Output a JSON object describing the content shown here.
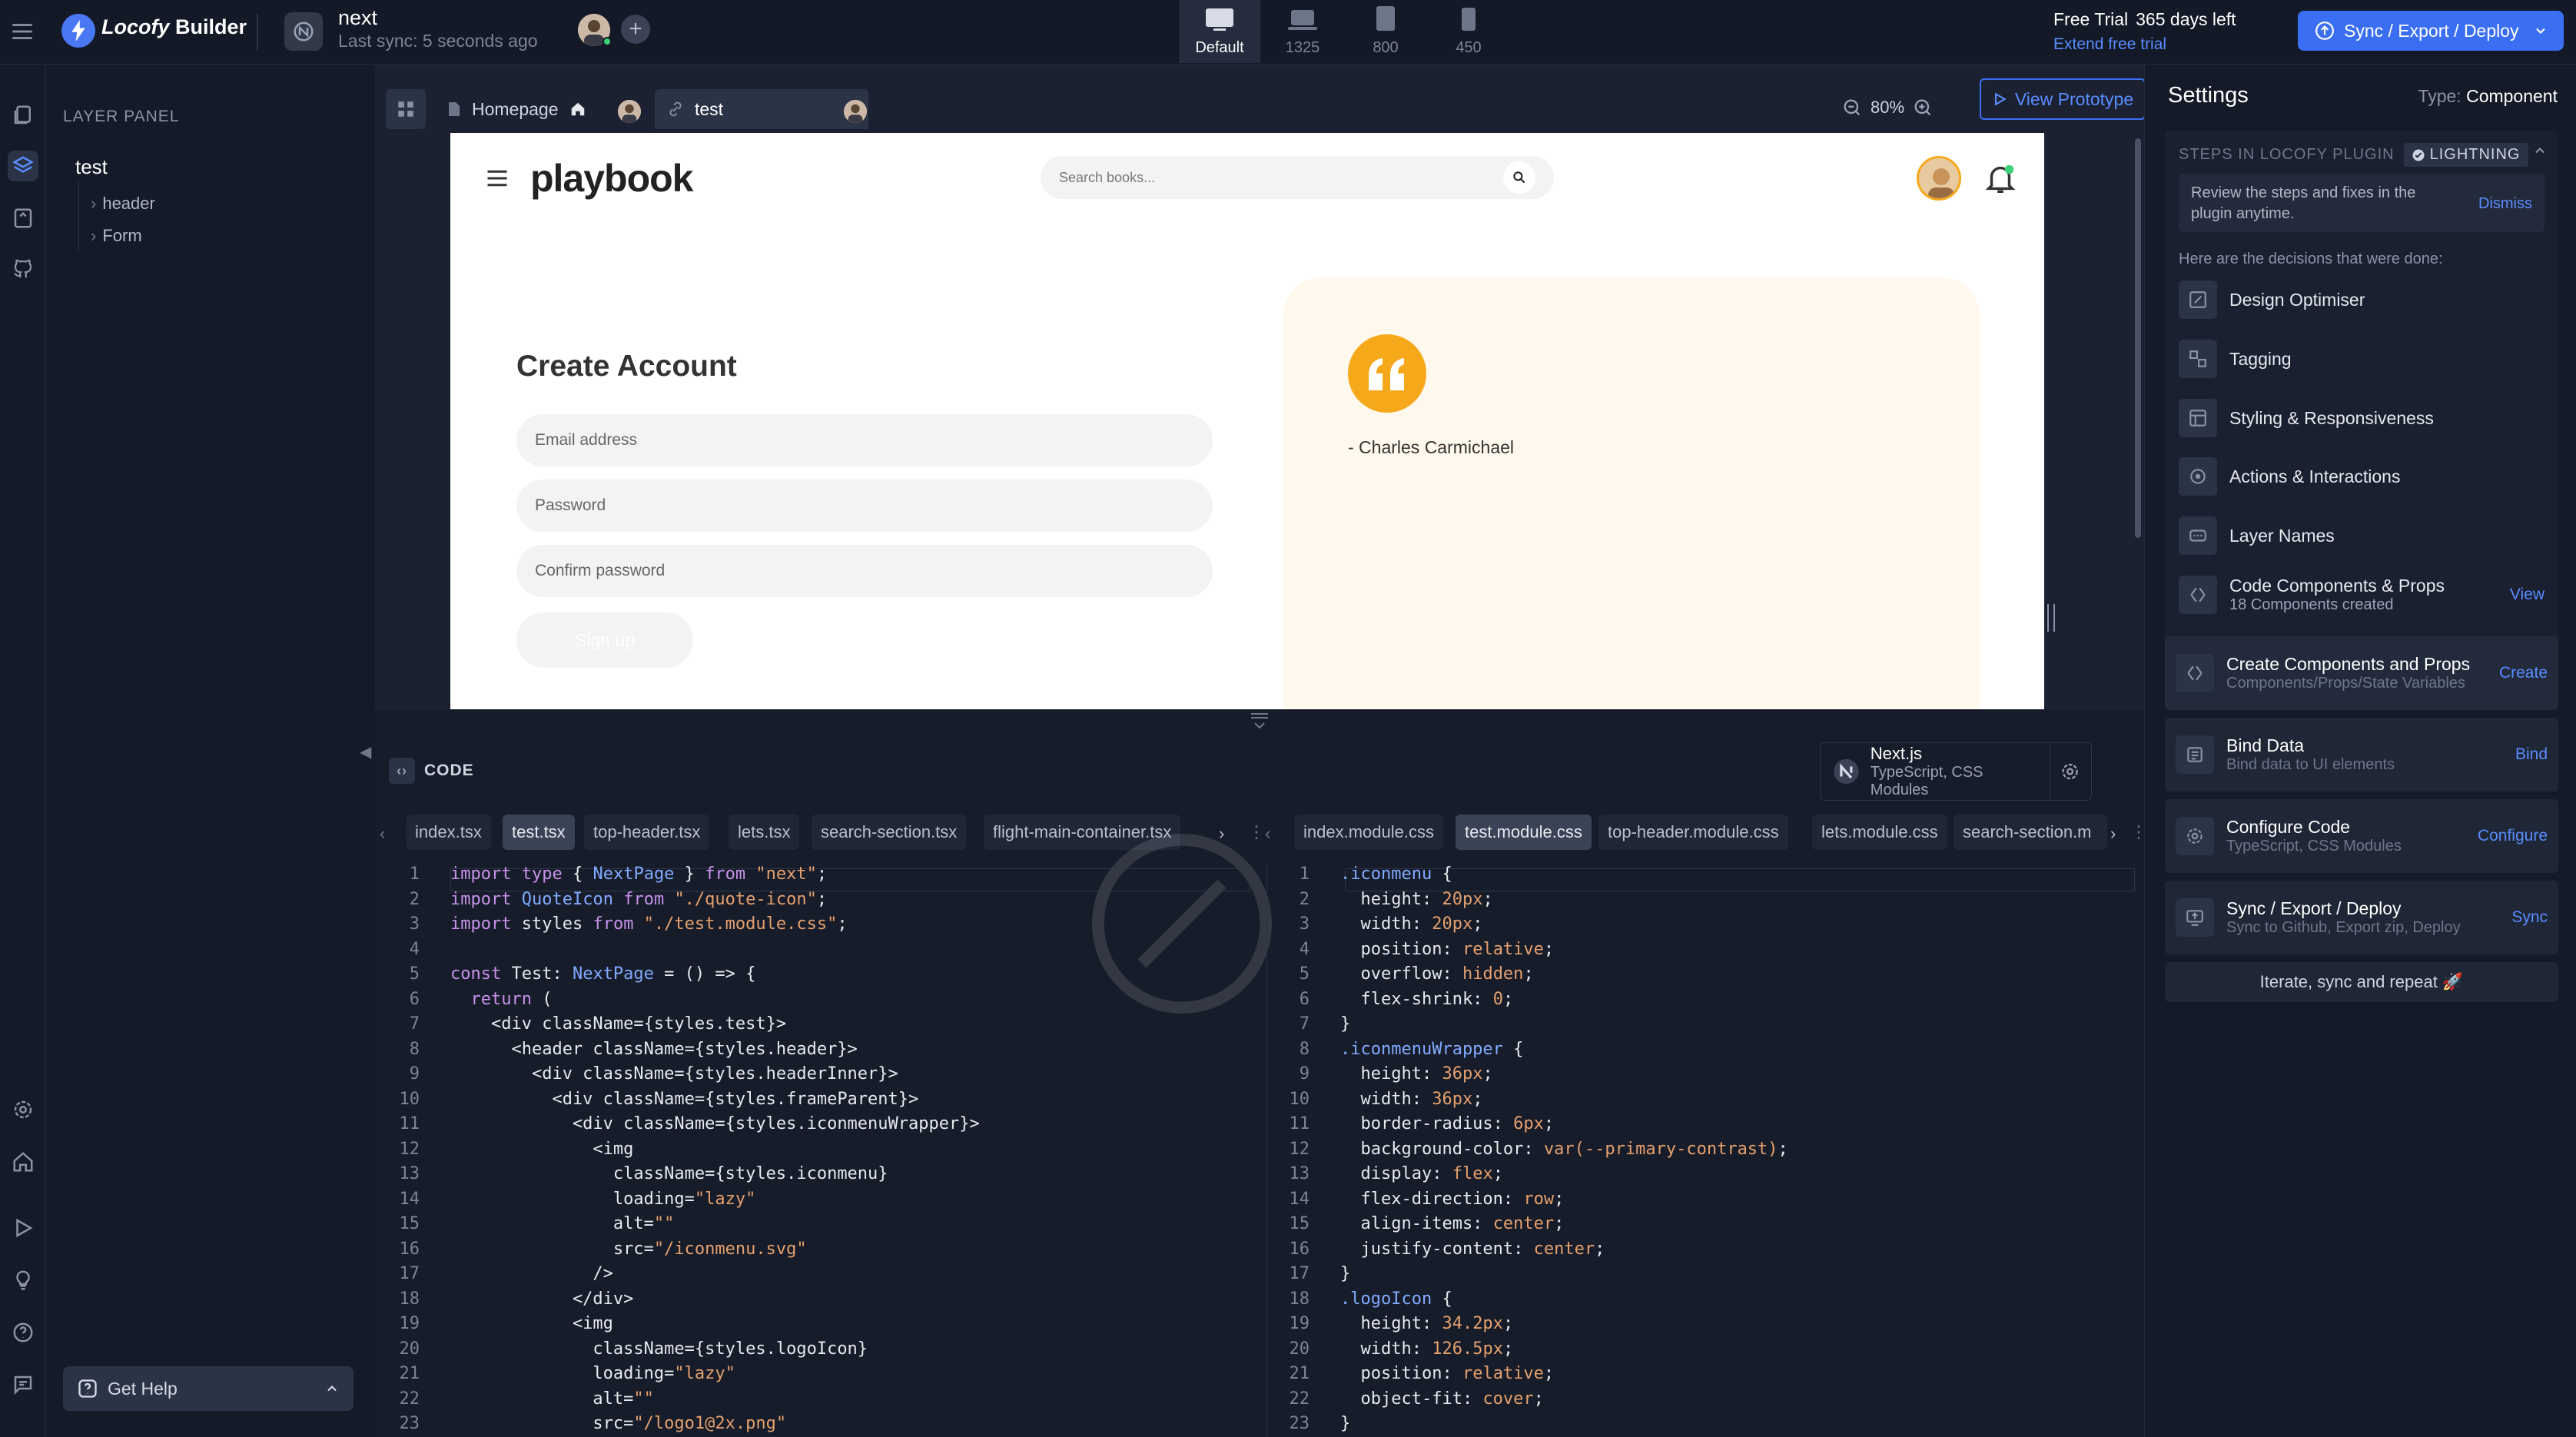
{
  "app": {
    "brand": "Locofy",
    "brand_suffix": "Builder"
  },
  "project": {
    "name": "next",
    "last_sync": "Last sync: 5 seconds ago"
  },
  "devices": [
    {
      "label": "Default"
    },
    {
      "label": "1325"
    },
    {
      "label": "800"
    },
    {
      "label": "450"
    }
  ],
  "trial": {
    "label": "Free Trial",
    "days": "365 days left",
    "extend": "Extend free trial"
  },
  "sync_button": {
    "label": "Sync / Export / Deploy"
  },
  "layer_panel": {
    "title": "LAYER PANEL",
    "root": "test",
    "items": [
      "header",
      "Form"
    ],
    "help": "Get Help"
  },
  "canvas": {
    "tabs": [
      {
        "label": "Homepage"
      },
      {
        "label": "test"
      }
    ],
    "zoom": "80%",
    "view_prototype": "View Prototype"
  },
  "preview": {
    "logo": "playbook",
    "search_placeholder": "Search books...",
    "title": "Create Account",
    "fields": [
      "Email address",
      "Password",
      "Confirm password"
    ],
    "signup": "Sign up",
    "quote_author": "- Charles Carmichael",
    "colors": {
      "accent": "#f6a81b",
      "card": "#fff8ec"
    }
  },
  "code": {
    "title": "CODE",
    "framework": {
      "name": "Next.js",
      "sub": "TypeScript, CSS Modules"
    },
    "left_files": [
      "index.tsx",
      "test.tsx",
      "top-header.tsx",
      "lets.tsx",
      "search-section.tsx",
      "flight-main-container.tsx"
    ],
    "right_files": [
      "index.module.css",
      "test.module.css",
      "top-header.module.css",
      "lets.module.css",
      "search-section.m"
    ],
    "left_lines": [
      "import type { NextPage } from \"next\";",
      "import QuoteIcon from \"./quote-icon\";",
      "import styles from \"./test.module.css\";",
      "",
      "const Test: NextPage = () => {",
      "  return (",
      "    <div className={styles.test}>",
      "      <header className={styles.header}>",
      "        <div className={styles.headerInner}>",
      "          <div className={styles.frameParent}>",
      "            <div className={styles.iconmenuWrapper}>",
      "              <img",
      "                className={styles.iconmenu}",
      "                loading=\"lazy\"",
      "                alt=\"\"",
      "                src=\"/iconmenu.svg\"",
      "              />",
      "            </div>",
      "            <img",
      "              className={styles.logoIcon}",
      "              loading=\"lazy\"",
      "              alt=\"\"",
      "              src=\"/logo1@2x.png\""
    ],
    "right_lines": [
      ".iconmenu {",
      "  height: 20px;",
      "  width: 20px;",
      "  position: relative;",
      "  overflow: hidden;",
      "  flex-shrink: 0;",
      "}",
      ".iconmenuWrapper {",
      "  height: 36px;",
      "  width: 36px;",
      "  border-radius: 6px;",
      "  background-color: var(--primary-contrast);",
      "  display: flex;",
      "  flex-direction: row;",
      "  align-items: center;",
      "  justify-content: center;",
      "}",
      ".logoIcon {",
      "  height: 34.2px;",
      "  width: 126.5px;",
      "  position: relative;",
      "  object-fit: cover;",
      "}"
    ]
  },
  "settings": {
    "title": "Settings",
    "type_label": "Type:",
    "type_value": "Component",
    "steps_header": "STEPS IN LOCOFY PLUGIN",
    "badge": "LIGHTNING",
    "review": "Review the steps and fixes in the plugin anytime.",
    "dismiss": "Dismiss",
    "decisions": "Here are the decisions that were done:",
    "steps": [
      {
        "label": "Design Optimiser"
      },
      {
        "label": "Tagging"
      },
      {
        "label": "Styling & Responsiveness"
      },
      {
        "label": "Actions & Interactions"
      },
      {
        "label": "Layer Names"
      },
      {
        "label": "Code Components & Props",
        "sub": "18 Components created",
        "link": "View"
      }
    ],
    "actions": [
      {
        "title": "Create Components and Props",
        "sub": "Components/Props/State Variables",
        "link": "Create"
      },
      {
        "title": "Bind Data",
        "sub": "Bind data to UI elements",
        "link": "Bind"
      },
      {
        "title": "Configure Code",
        "sub": "TypeScript, CSS Modules",
        "link": "Configure"
      },
      {
        "title": "Sync / Export / Deploy",
        "sub": "Sync to Github, Export zip, Deploy",
        "link": "Sync"
      }
    ],
    "iterate": "Iterate, sync and repeat 🚀"
  }
}
